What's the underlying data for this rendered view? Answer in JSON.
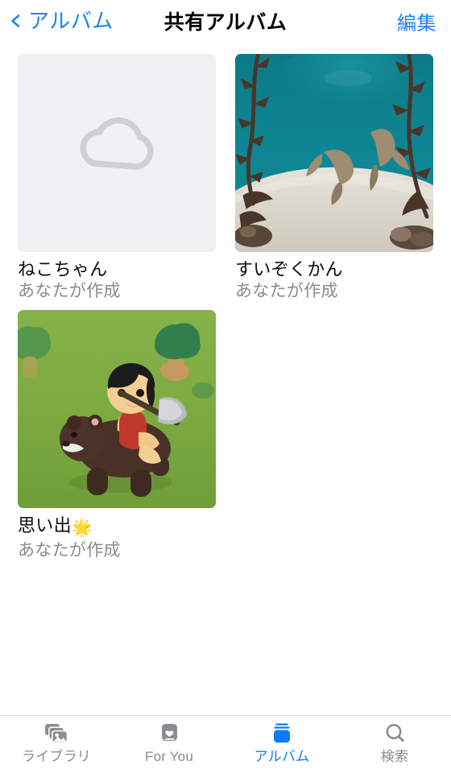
{
  "nav": {
    "back_label": "アルバム",
    "back_icon": "chevron-left-icon",
    "title": "共有アルバム",
    "edit_label": "編集",
    "accent_color": "#1a84f5"
  },
  "albums": [
    {
      "title": "ねこちゃん",
      "subtitle": "あなたが作成",
      "thumbnail": "cloud-placeholder",
      "placeholder_bg": "#f1f1f3",
      "placeholder_icon": "cloud-icon",
      "placeholder_icon_color": "#cfcfd4"
    },
    {
      "title": "すいぞくかん",
      "subtitle": "あなたが作成",
      "thumbnail": "aquarium-photo",
      "water_color": "#0d7f8c",
      "sand_color": "#ddd8cf",
      "plant_color": "#4a3a2d"
    },
    {
      "title": "思い出",
      "title_emoji": "🌟",
      "subtitle": "あなたが作成",
      "thumbnail": "clay-diorama-photo",
      "grass_color": "#7da93f",
      "tree_color": "#2e7d4f",
      "bear_color": "#4a3127",
      "skin_color": "#f0c98a"
    }
  ],
  "tabs": [
    {
      "label": "ライブラリ",
      "icon": "photo-stack-icon",
      "active": false
    },
    {
      "label": "For You",
      "icon": "heart-card-icon",
      "active": false
    },
    {
      "label": "アルバム",
      "icon": "albums-icon",
      "active": true
    },
    {
      "label": "検索",
      "icon": "search-icon",
      "active": false
    }
  ],
  "colors": {
    "tab_inactive": "#8b8b90",
    "tab_active": "#0a7cf5",
    "title_text": "#0d0d0d",
    "subtitle_text": "#8b8b90"
  }
}
